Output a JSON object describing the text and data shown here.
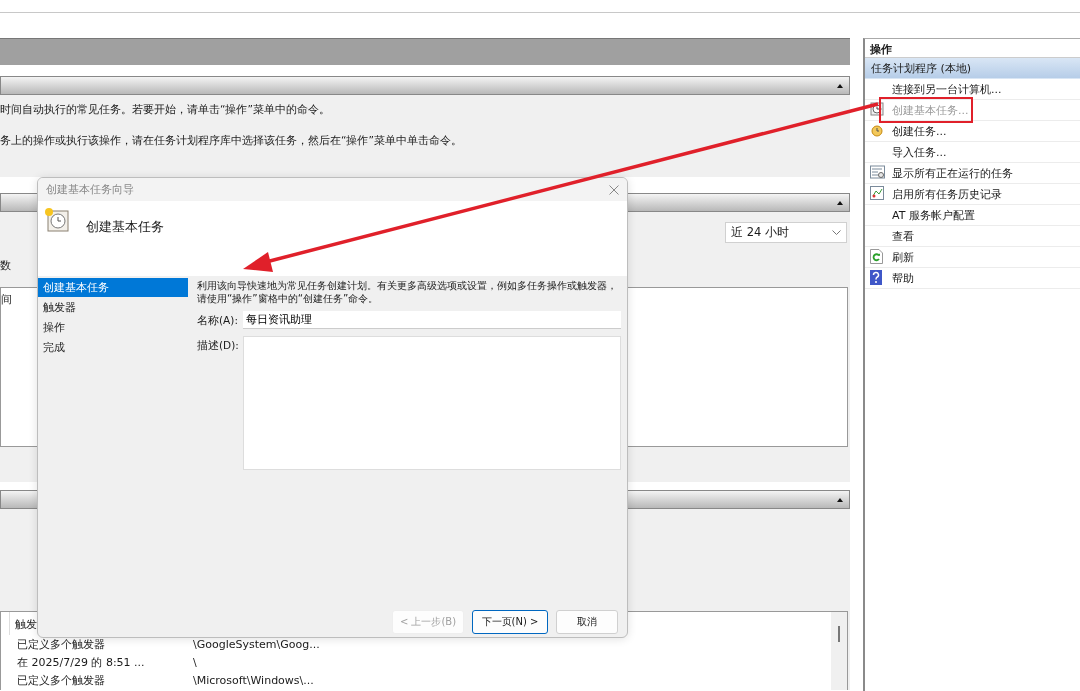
{
  "main": {
    "overview_lines": [
      "时间自动执行的常见任务。若要开始，请单击“操作”菜单中的命令。",
      "务上的操作或执行该操作，请在任务计划程序库中选择该任务，然后在“操作”菜单中单击命令。"
    ],
    "status_fragment": "数",
    "range_select": {
      "value": "近 24 小时"
    },
    "list_column_fragment": "间",
    "tasks_table": {
      "columns": [
        "触发"
      ],
      "rows": [
        {
          "cells": [
            "已定义多个触发器",
            "\\GoogleSystem\\Goog..."
          ]
        },
        {
          "cells": [
            "在 2025/7/29 的 8:51 ...",
            "\\"
          ]
        },
        {
          "cells": [
            "已定义多个触发器",
            "\\Microsoft\\Windows\\..."
          ]
        }
      ]
    }
  },
  "actions_pane": {
    "title": "操作",
    "items": [
      {
        "label": "任务计划程序 (本地)",
        "kind": "group",
        "selected": true,
        "disabled": false
      },
      {
        "label": "连接到另一台计算机...",
        "kind": "action",
        "selected": false,
        "disabled": false
      },
      {
        "label": "创建基本任务...",
        "kind": "action",
        "selected": false,
        "disabled": true
      },
      {
        "label": "创建任务...",
        "kind": "action",
        "selected": false,
        "disabled": false
      },
      {
        "label": "导入任务...",
        "kind": "action",
        "selected": false,
        "disabled": false
      },
      {
        "label": "显示所有正在运行的任务",
        "kind": "action",
        "selected": false,
        "disabled": false
      },
      {
        "label": "启用所有任务历史记录",
        "kind": "action",
        "selected": false,
        "disabled": false
      },
      {
        "label": "AT 服务帐户配置",
        "kind": "action",
        "selected": false,
        "disabled": false
      },
      {
        "label": "查看",
        "kind": "action",
        "selected": false,
        "disabled": false
      },
      {
        "label": "刷新",
        "kind": "action",
        "selected": false,
        "disabled": false
      },
      {
        "label": "帮助",
        "kind": "action",
        "selected": false,
        "disabled": false
      }
    ]
  },
  "dialog": {
    "title": "创建基本任务向导",
    "heading": "创建基本任务",
    "steps": [
      {
        "label": "创建基本任务",
        "selected": true
      },
      {
        "label": "触发器",
        "selected": false
      },
      {
        "label": "操作",
        "selected": false
      },
      {
        "label": "完成",
        "selected": false
      }
    ],
    "description": "利用该向导快速地为常见任务创建计划。有关更多高级选项或设置，例如多任务操作或触发器，请使用“操作”窗格中的“创建任务”命令。",
    "name_label": "名称(A):",
    "name_value": "每日资讯助理",
    "desc_label": "描述(D):",
    "buttons": [
      {
        "label": "< 上一步(B)",
        "disabled": true,
        "focused": false
      },
      {
        "label": "下一页(N) >",
        "disabled": false,
        "focused": true
      },
      {
        "label": "取消",
        "disabled": false,
        "focused": false
      }
    ]
  }
}
